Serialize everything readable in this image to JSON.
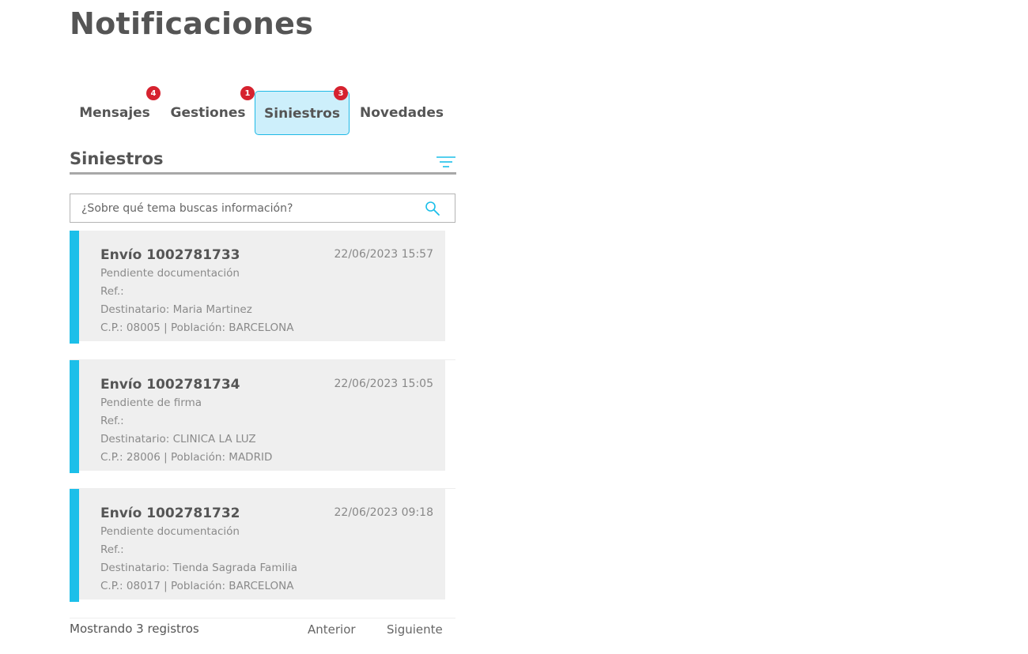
{
  "page": {
    "title": "Notificaciones"
  },
  "tabs": [
    {
      "label": "Mensajes",
      "badge": "4",
      "active": false
    },
    {
      "label": "Gestiones",
      "badge": "1",
      "active": false
    },
    {
      "label": "Siniestros",
      "badge": "3",
      "active": true
    },
    {
      "label": "Novedades",
      "badge": "",
      "active": false
    }
  ],
  "section": {
    "title": "Siniestros",
    "filter_icon": "filter-icon"
  },
  "search": {
    "placeholder": "¿Sobre qué tema buscas información?",
    "value": "",
    "icon": "search-icon"
  },
  "cards": [
    {
      "title": "Envío 1002781733",
      "date": "22/06/2023 15:57",
      "status": "Pendiente documentación",
      "ref": "Ref.:",
      "recipient": "Destinatario: Maria Martinez",
      "location": "C.P.: 08005 | Población: BARCELONA"
    },
    {
      "title": "Envío 1002781734",
      "date": "22/06/2023 15:05",
      "status": "Pendiente de firma",
      "ref": "Ref.:",
      "recipient": "Destinatario: CLINICA LA LUZ",
      "location": "C.P.: 28006 | Población: MADRID"
    },
    {
      "title": "Envío 1002781732",
      "date": "22/06/2023 09:18",
      "status": "Pendiente documentación",
      "ref": "Ref.:",
      "recipient": "Destinatario: Tienda Sagrada Familia",
      "location": "C.P.: 08017 | Población: BARCELONA"
    }
  ],
  "footer": {
    "records": "Mostrando 3 registros",
    "prev_label": "Anterior",
    "next_label": "Siguiente"
  },
  "colors": {
    "accent": "#1cbfe9",
    "badge": "#d6222f",
    "active_tab_bg": "#cdeffb",
    "card_bg": "#efefef"
  }
}
